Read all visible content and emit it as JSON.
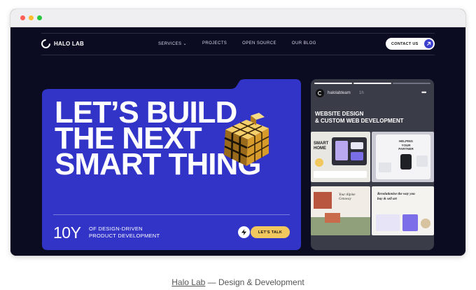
{
  "window": {
    "controls": [
      {
        "name": "close",
        "color": "#ff5f57"
      },
      {
        "name": "minimize",
        "color": "#febc2e"
      },
      {
        "name": "maximize",
        "color": "#28c840"
      }
    ]
  },
  "nav": {
    "logo_text": "HALO LAB",
    "menu": [
      "SERVICES",
      "PROJECTS",
      "OPEN SOURCE",
      "OUR BLOG"
    ],
    "contact_label": "CONTACT US"
  },
  "hero": {
    "headline": [
      "LET’S BUILD",
      "THE NEXT",
      "SMART THING"
    ],
    "stat_number": "10Y",
    "stat_text": [
      "OF DESIGN-DRIVEN",
      "PRODUCT DEVELOPMENT"
    ],
    "cta_label": "LET’S TALK",
    "colors": {
      "panel": "#3234c8",
      "cta": "#f2c75e"
    }
  },
  "story": {
    "username": "halolabteam",
    "time": "1h",
    "title": [
      "WEBSITE DESIGN",
      "& CUSTOM WEB DEVELOPMENT"
    ],
    "progress": [
      1,
      1,
      0
    ],
    "thumbnails": [
      {
        "text": "SMART HOME"
      },
      {
        "text": "HELPING YOUR PARTNER"
      },
      {
        "text": "Your Alpine Getaway"
      },
      {
        "text": "Revolutionise the way you buy & sell art"
      }
    ]
  },
  "caption": {
    "link": "Halo Lab",
    "rest": " — Design & Development"
  }
}
